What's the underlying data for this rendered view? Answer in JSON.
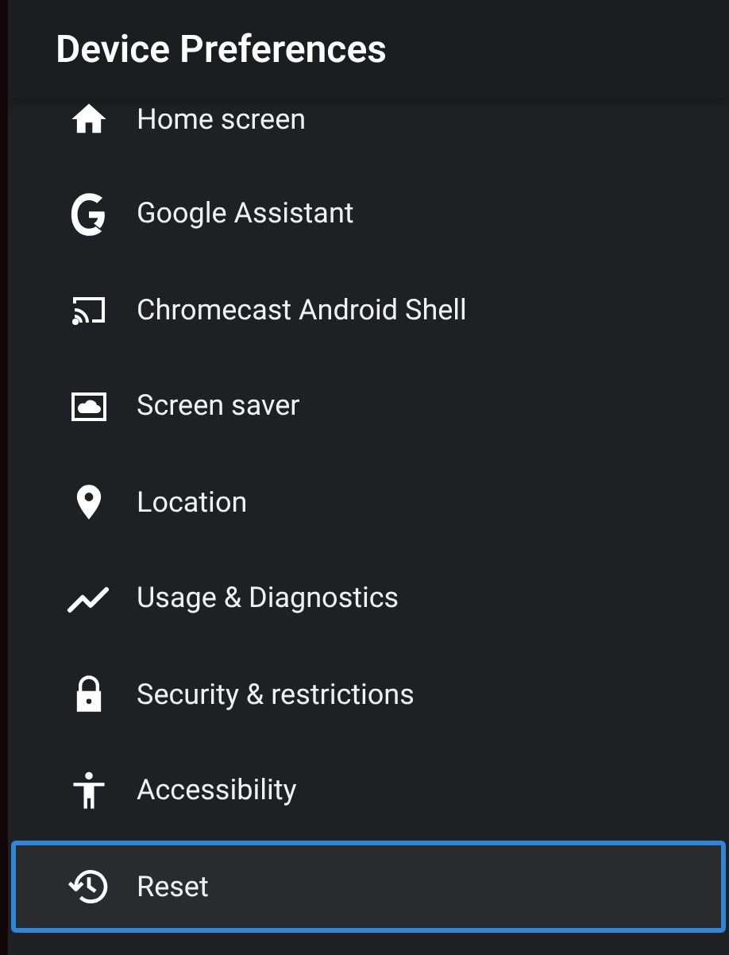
{
  "header": {
    "title": "Device Preferences"
  },
  "items": [
    {
      "label": "Home screen",
      "selected": false
    },
    {
      "label": "Google Assistant",
      "selected": false
    },
    {
      "label": "Chromecast Android Shell",
      "selected": false
    },
    {
      "label": "Screen saver",
      "selected": false
    },
    {
      "label": "Location",
      "selected": false
    },
    {
      "label": "Usage & Diagnostics",
      "selected": false
    },
    {
      "label": "Security & restrictions",
      "selected": false
    },
    {
      "label": "Accessibility",
      "selected": false
    },
    {
      "label": "Reset",
      "selected": true
    }
  ]
}
